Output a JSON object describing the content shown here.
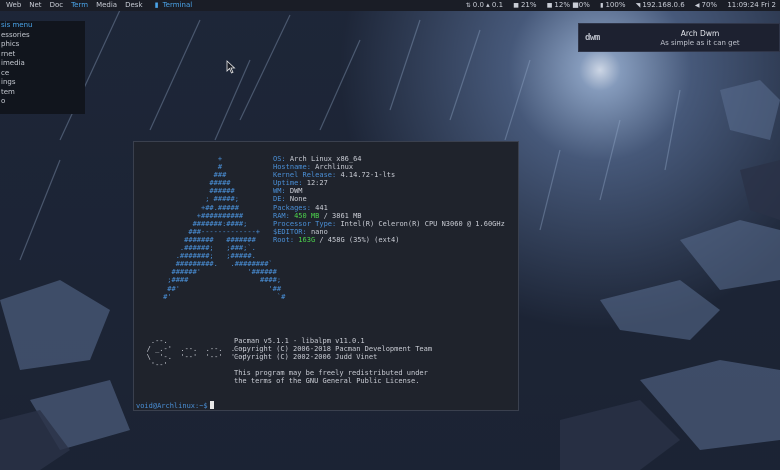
{
  "topbar": {
    "tags": [
      "Web",
      "Net",
      "Doc",
      "Term",
      "Media",
      "Desk"
    ],
    "active_tag": "Term",
    "window_title": "Terminal",
    "status": {
      "net": "0.0 ▴ 0.1",
      "disk": "21%",
      "mem": "12% ■0%",
      "battery": "100%",
      "ip": "192.168.0.6",
      "volume": "70%",
      "clock": "11:09:24 Fri 2"
    }
  },
  "menu": {
    "title": "sis menu",
    "items": [
      "essories",
      "phics",
      "rnet",
      "imedia",
      "ce",
      "ings",
      "tem",
      "o"
    ]
  },
  "notification": {
    "logo": "dwm",
    "title": "Arch Dwm",
    "body": "As simple as it can get"
  },
  "terminal": {
    "ascii_art": "                  +\n                  #\n                 ###\n                #####\n                ######\n               ; #####;\n              +##.#####\n             +##########\n            #######:####;\n           ###-------------+\n          #######   #######\n         .######;   ;###;`.\n        .#######;   ;#####.\n        #########.   .########`\n       ######'           '######\n      ;####                 ####;\n      ##'                     '##\n     #'                         `#",
    "info": [
      {
        "key": "OS:",
        "value": "Arch Linux x86_64"
      },
      {
        "key": "Hostname:",
        "value": "Archlinux"
      },
      {
        "key": "Kernel Release:",
        "value": "4.14.72-1-lts"
      },
      {
        "key": "Uptime:",
        "value": "12:27"
      },
      {
        "key": "WM:",
        "value": "DWM"
      },
      {
        "key": "DE:",
        "value": "None"
      },
      {
        "key": "Packages:",
        "value": "441"
      },
      {
        "key": "RAM:",
        "value_green": "450 MB",
        "value": " / 3861 MB"
      },
      {
        "key": "Processor Type:",
        "value": "Intel(R) Celeron(R) CPU  N3060  @ 1.60GHz"
      },
      {
        "key": "$EDITOR:",
        "value": "nano"
      },
      {
        "key": "Root:",
        "value_green": "163G",
        "value": " / 458G (35%) (ext4)"
      }
    ],
    "pac_art": "    .--.\n   / _.-'  .--.  .--.  .--.\n   \\  '-.  '--'  '--'  '--'\n    '--'",
    "pacman_lines": [
      "Pacman v5.1.1 - libalpm v11.0.1",
      "Copyright (C) 2006-2018 Pacman Development Team",
      "Copyright (C) 2002-2006 Judd Vinet",
      "",
      "This program may be freely redistributed under",
      "the terms of the GNU General Public License."
    ],
    "prompt": "void@Archlinux:~$"
  }
}
